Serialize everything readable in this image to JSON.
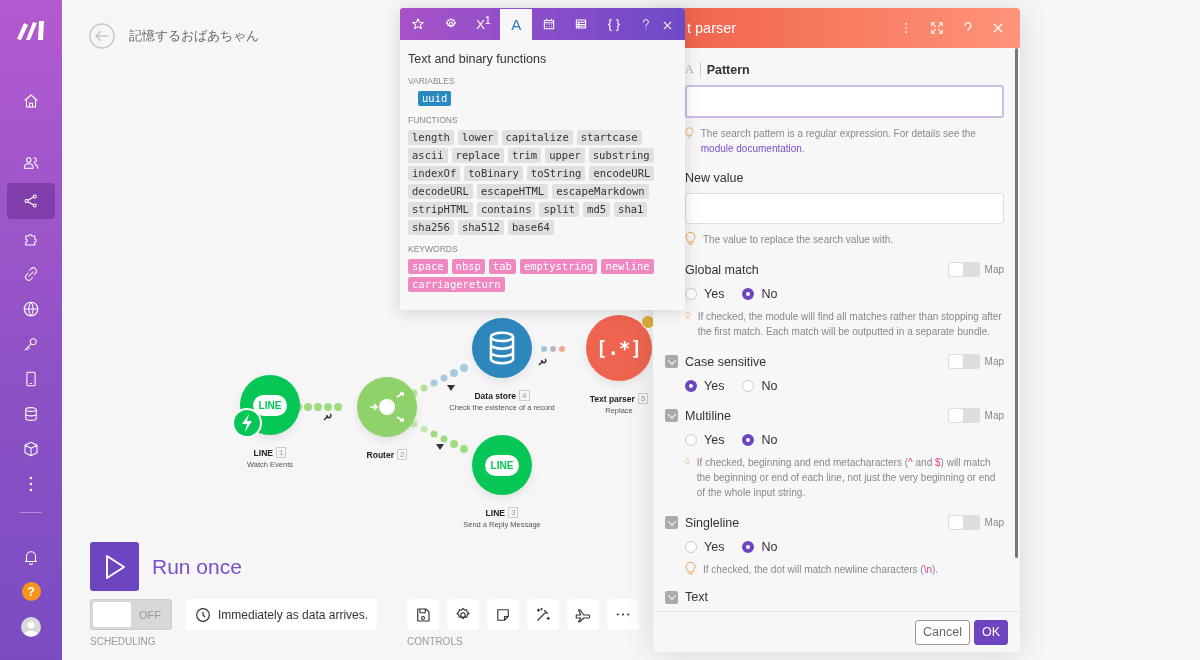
{
  "sidebar": {
    "items": [
      {
        "selected": false
      },
      {
        "selected": false
      },
      {
        "selected": true
      },
      {
        "selected": false
      },
      {
        "selected": false
      },
      {
        "selected": false
      },
      {
        "selected": false
      },
      {
        "selected": false
      },
      {
        "selected": false
      },
      {
        "selected": false
      },
      {
        "selected": false
      }
    ],
    "help_label": "?"
  },
  "header": {
    "title": "記憶するおばあちゃん"
  },
  "nodes": [
    {
      "kind": "line",
      "icon_text": "LINE",
      "name": "LINE",
      "number": "1",
      "subtitle": "Watch Events",
      "trigger": true,
      "warning": false
    },
    {
      "kind": "router",
      "name": "Router",
      "number": "2",
      "trigger": false,
      "warning": false
    },
    {
      "kind": "datastore",
      "name": "Data store",
      "number": "4",
      "subtitle": "Check the existence of a record",
      "trigger": false,
      "warning": false
    },
    {
      "kind": "line",
      "icon_text": "LINE",
      "name": "LINE",
      "number": "3",
      "subtitle": "Send a Reply Message",
      "trigger": false,
      "warning": false
    },
    {
      "kind": "textparser",
      "icon_text": "[.*]",
      "name": "Text parser",
      "number": "5",
      "subtitle": "Replace",
      "trigger": false,
      "warning": true
    }
  ],
  "run": {
    "label": "Run once"
  },
  "scheduling": {
    "toggle_label": "OFF",
    "on": false,
    "schedule": "Immediately as data arrives.",
    "caption": "SCHEDULING"
  },
  "controls": {
    "caption": "CONTROLS"
  },
  "function_panel": {
    "tabs": [
      {
        "selected": false
      },
      {
        "selected": false
      },
      {
        "label": "X$^{1}$",
        "selected": false
      },
      {
        "label": "A",
        "selected": true
      },
      {
        "selected": false
      },
      {
        "selected": false
      },
      {
        "label": "{ }",
        "selected": false
      }
    ],
    "title": "Text and binary functions",
    "sections": [
      {
        "heading": "VARIABLES",
        "kind": "variable",
        "items": [
          "uuid"
        ]
      },
      {
        "heading": "FUNCTIONS",
        "kind": "function",
        "items": [
          "length",
          "lower",
          "capitalize",
          "startcase",
          "ascii",
          "replace",
          "trim",
          "upper",
          "substring",
          "indexOf",
          "toBinary",
          "toString",
          "encodeURL",
          "decodeURL",
          "escapeHTML",
          "escapeMarkdown",
          "stripHTML",
          "contains",
          "split",
          "md5",
          "sha1",
          "sha256",
          "sha512",
          "base64"
        ]
      },
      {
        "heading": "KEYWORDS",
        "kind": "keyword",
        "items": [
          "space",
          "nbsp",
          "tab",
          "emptystring",
          "newline",
          "carriagereturn"
        ]
      }
    ]
  },
  "module_panel": {
    "title": "t parser",
    "fields": [
      {
        "kind": "text",
        "type_glyph": "A",
        "label": "Pattern",
        "focused": true,
        "hint": [
          {
            "kind": "text",
            "text": "The search pattern is a regular expression. For details see the "
          },
          {
            "kind": "link",
            "text": "module documentation"
          },
          {
            "kind": "text",
            "text": "."
          }
        ]
      },
      {
        "kind": "text",
        "label": "New value",
        "focused": false,
        "hint": [
          {
            "kind": "text",
            "text": "The value to replace the search value with."
          }
        ]
      },
      {
        "kind": "radio",
        "label": "Global match",
        "map": {
          "label": "Map",
          "on": false
        },
        "options": [
          {
            "label": "Yes",
            "selected": false
          },
          {
            "label": "No",
            "selected": true
          }
        ],
        "hint": [
          {
            "kind": "text",
            "text": "If checked, the module will find all matches rather than stopping after the first match. Each match will be outputted in a separate bundle."
          }
        ]
      },
      {
        "kind": "radio",
        "label": "Case sensitive",
        "checked": true,
        "map": {
          "label": "Map",
          "on": false
        },
        "options": [
          {
            "label": "Yes",
            "selected": true
          },
          {
            "label": "No",
            "selected": false
          }
        ]
      },
      {
        "kind": "radio",
        "label": "Multiline",
        "checked": true,
        "map": {
          "label": "Map",
          "on": false
        },
        "options": [
          {
            "label": "Yes",
            "selected": false
          },
          {
            "label": "No",
            "selected": true
          }
        ],
        "hint": [
          {
            "kind": "text",
            "text": "If checked, beginning and end metacharacters ("
          },
          {
            "kind": "code",
            "text": "^"
          },
          {
            "kind": "text",
            "text": " and "
          },
          {
            "kind": "code",
            "text": "$"
          },
          {
            "kind": "text",
            "text": ") will match the beginning or end of each line, not just the very beginning or end of the whole input string."
          }
        ]
      },
      {
        "kind": "radio",
        "label": "Singleline",
        "checked": true,
        "map": {
          "label": "Map",
          "on": false
        },
        "options": [
          {
            "label": "Yes",
            "selected": false
          },
          {
            "label": "No",
            "selected": true
          }
        ],
        "hint": [
          {
            "kind": "text",
            "text": "If checked, the dot will match newline characters ("
          },
          {
            "kind": "code",
            "text": "\\n"
          },
          {
            "kind": "text",
            "text": ")."
          }
        ]
      },
      {
        "kind": "heading",
        "label": "Text",
        "checked": true
      }
    ],
    "buttons": [
      {
        "kind": "secondary",
        "label": "Cancel"
      },
      {
        "kind": "primary",
        "label": "OK"
      }
    ]
  }
}
